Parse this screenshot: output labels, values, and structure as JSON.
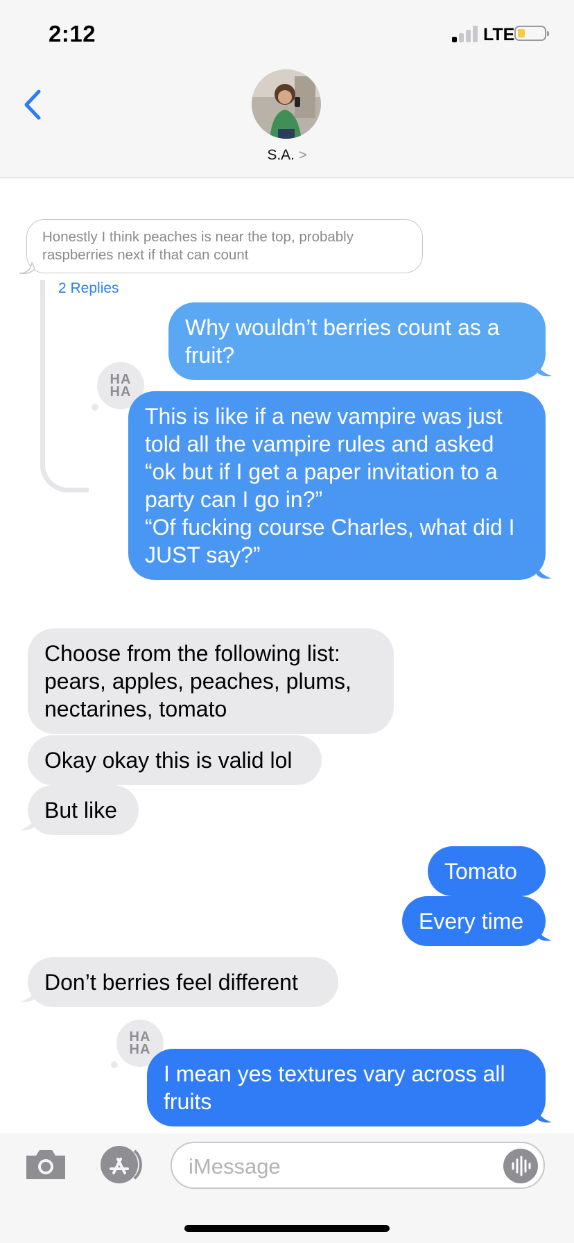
{
  "status": {
    "time": "2:12",
    "network": "LTE"
  },
  "header": {
    "contact_name": "S.A.",
    "chevron": ">"
  },
  "thread": {
    "quoted_message": "Honestly I think peaches is near the top, probably raspberries next if that can count",
    "replies_label": "2 Replies"
  },
  "messages": {
    "m1": "Why wouldn’t berries count as a fruit?",
    "m2": "This is like if a new vampire was just told all the vampire rules and asked “ok but if I get a paper invitation to a party can I go in?”\n“Of fucking course Charles, what did I JUST say?”",
    "m3": "Choose from the following list: pears, apples, peaches, plums, nectarines, tomato",
    "m4": "Okay okay this is valid lol",
    "m5": "But like",
    "m6": "Tomato",
    "m7": "Every time",
    "m8": "Don’t berries feel different",
    "m9": "I mean yes textures vary across all fruits"
  },
  "reactions": {
    "haha_top": "HA",
    "haha_bottom": "HA"
  },
  "input": {
    "placeholder": "iMessage"
  },
  "colors": {
    "imessage_blue": "#2f7cf6",
    "received_gray": "#e9e9eb",
    "link_blue": "#2c7cf6"
  },
  "icons": [
    "back-chevron-icon",
    "camera-icon",
    "app-store-icon",
    "audio-waveform-icon",
    "signal-icon",
    "battery-icon"
  ]
}
